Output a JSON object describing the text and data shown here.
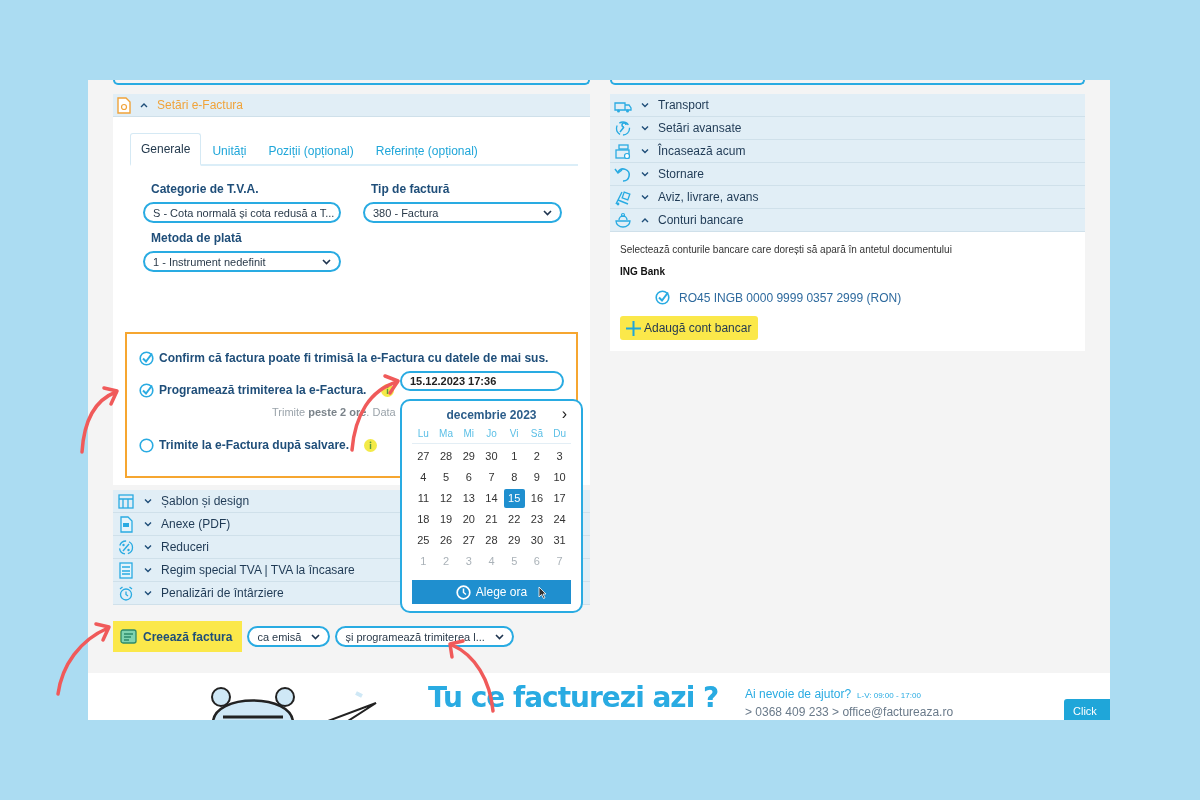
{
  "efactura": {
    "title": "Setări e-Factura",
    "expanded": true,
    "tabs": [
      {
        "label": "Generale",
        "selected": true
      },
      {
        "label": "Unități",
        "selected": false
      },
      {
        "label": "Poziții (opțional)",
        "selected": false
      },
      {
        "label": "Referințe (opțional)",
        "selected": false
      }
    ],
    "fields": [
      {
        "label": "Categorie de T.V.A.",
        "value": "S - Cota normală și cota redusă a T..."
      },
      {
        "label": "Tip de factură",
        "value": "380 - Factura"
      },
      {
        "label": "Metoda de plată",
        "value": "1 - Instrument nedefinit"
      }
    ],
    "options": [
      {
        "label": "Confirm că factura poate fi trimisă la e-Factura cu datele de mai sus.",
        "checked": true,
        "info": false
      },
      {
        "label": "Programează trimiterea la e-Factura.",
        "checked": true,
        "info": true
      },
      {
        "label": "Trimite la e-Factura după salvare.",
        "checked": false,
        "info": true
      }
    ],
    "schedule_value": "15.12.2023 17:36",
    "hint": "Trimite **peste 2 ore**. Data"
  },
  "left_sections": [
    {
      "label": "Șablon și design",
      "expanded": false
    },
    {
      "label": "Anexe (PDF)",
      "expanded": false
    },
    {
      "label": "Reduceri",
      "expanded": false
    },
    {
      "label": "Regim special TVA | TVA la încasare",
      "expanded": false
    },
    {
      "label": "Penalizări de întârziere",
      "expanded": false
    }
  ],
  "actions": {
    "create_button": "Creează factura",
    "selects": [
      "ca emisă",
      "și programează trimiterea l..."
    ]
  },
  "right_sections": [
    {
      "label": "Transport",
      "expanded": false
    },
    {
      "label": "Setări avansate",
      "expanded": false
    },
    {
      "label": "Încasează acum",
      "expanded": false
    },
    {
      "label": "Stornare",
      "expanded": false
    },
    {
      "label": "Aviz, livrare, avans",
      "expanded": false
    },
    {
      "label": "Conturi bancare",
      "expanded": true
    }
  ],
  "bank_accounts": {
    "intro": "Selectează conturile bancare care dorești să apară în antetul documentului",
    "bank": "ING Bank",
    "accounts": [
      {
        "iban": "RO45 INGB 0000 9999 0357 2999 (RON)",
        "checked": true
      }
    ],
    "add_button": "Adaugă cont bancar"
  },
  "calendar": {
    "month": "decembrie 2023",
    "next": "›",
    "weekdays": [
      "Lu",
      "Ma",
      "Mi",
      "Jo",
      "Vi",
      "Să",
      "Du"
    ],
    "weeks": [
      [
        {
          "day": "27",
          "selected": false,
          "outside": false
        },
        {
          "day": "28",
          "selected": false,
          "outside": false
        },
        {
          "day": "29",
          "selected": false,
          "outside": false
        },
        {
          "day": "30",
          "selected": false,
          "outside": false
        },
        {
          "day": "1",
          "selected": false,
          "outside": false
        },
        {
          "day": "2",
          "selected": false,
          "outside": false
        },
        {
          "day": "3",
          "selected": false,
          "outside": false
        }
      ],
      [
        {
          "day": "4",
          "selected": false,
          "outside": false
        },
        {
          "day": "5",
          "selected": false,
          "outside": false
        },
        {
          "day": "6",
          "selected": false,
          "outside": false
        },
        {
          "day": "7",
          "selected": false,
          "outside": false
        },
        {
          "day": "8",
          "selected": false,
          "outside": false
        },
        {
          "day": "9",
          "selected": false,
          "outside": false
        },
        {
          "day": "10",
          "selected": false,
          "outside": false
        }
      ],
      [
        {
          "day": "11",
          "selected": false,
          "outside": false
        },
        {
          "day": "12",
          "selected": false,
          "outside": false
        },
        {
          "day": "13",
          "selected": false,
          "outside": false
        },
        {
          "day": "14",
          "selected": false,
          "outside": false
        },
        {
          "day": "15",
          "selected": true,
          "outside": false
        },
        {
          "day": "16",
          "selected": false,
          "outside": false
        },
        {
          "day": "17",
          "selected": false,
          "outside": false
        }
      ],
      [
        {
          "day": "18",
          "selected": false,
          "outside": false
        },
        {
          "day": "19",
          "selected": false,
          "outside": false
        },
        {
          "day": "20",
          "selected": false,
          "outside": false
        },
        {
          "day": "21",
          "selected": false,
          "outside": false
        },
        {
          "day": "22",
          "selected": false,
          "outside": false
        },
        {
          "day": "23",
          "selected": false,
          "outside": false
        },
        {
          "day": "24",
          "selected": false,
          "outside": false
        }
      ],
      [
        {
          "day": "25",
          "selected": false,
          "outside": false
        },
        {
          "day": "26",
          "selected": false,
          "outside": false
        },
        {
          "day": "27",
          "selected": false,
          "outside": false
        },
        {
          "day": "28",
          "selected": false,
          "outside": false
        },
        {
          "day": "29",
          "selected": false,
          "outside": false
        },
        {
          "day": "30",
          "selected": false,
          "outside": false
        },
        {
          "day": "31",
          "selected": false,
          "outside": false
        }
      ],
      [
        {
          "day": "1",
          "selected": false,
          "outside": true
        },
        {
          "day": "2",
          "selected": false,
          "outside": true
        },
        {
          "day": "3",
          "selected": false,
          "outside": true
        },
        {
          "day": "4",
          "selected": false,
          "outside": true
        },
        {
          "day": "5",
          "selected": false,
          "outside": true
        },
        {
          "day": "6",
          "selected": false,
          "outside": true
        },
        {
          "day": "7",
          "selected": false,
          "outside": true
        }
      ]
    ],
    "time_button": "Alege ora"
  },
  "footer": {
    "slogan": "Tu ce facturezi azi ?",
    "help_title": "Ai nevoie de ajutor?",
    "hours": "L-V: 09:00 - 17:00",
    "contacts": "> 0368 409 233 > office@factureaza.ro",
    "side_button": "Click"
  }
}
